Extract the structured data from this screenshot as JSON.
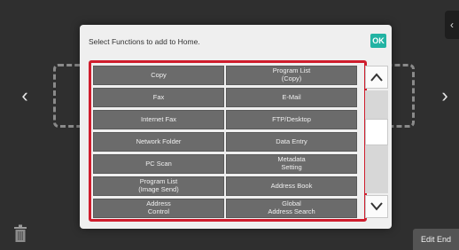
{
  "dialog": {
    "title": "Select Functions to add to Home.",
    "ok_label": "OK"
  },
  "functions": [
    "Copy",
    "Program List\n(Copy)",
    "Fax",
    "E-Mail",
    "Internet Fax",
    "FTP/Desktop",
    "Network Folder",
    "Data Entry",
    "PC Scan",
    "Metadata\nSetting",
    "Program List\n(Image Send)",
    "Address Book",
    "Address\nControl",
    "Global\nAddress Search"
  ],
  "footer": {
    "edit_end_label": "Edit End"
  },
  "icons": {
    "nav_left": "chevron-left-icon",
    "nav_right": "chevron-right-icon",
    "scroll_up": "chevron-up-icon",
    "scroll_down": "chevron-down-icon",
    "trash": "trash-icon",
    "side_tab": "chevron-left-small-icon"
  },
  "colors": {
    "ok_button": "#22b3a3",
    "highlight": "#cf1d2d",
    "function_button": "#6b6b6b"
  }
}
